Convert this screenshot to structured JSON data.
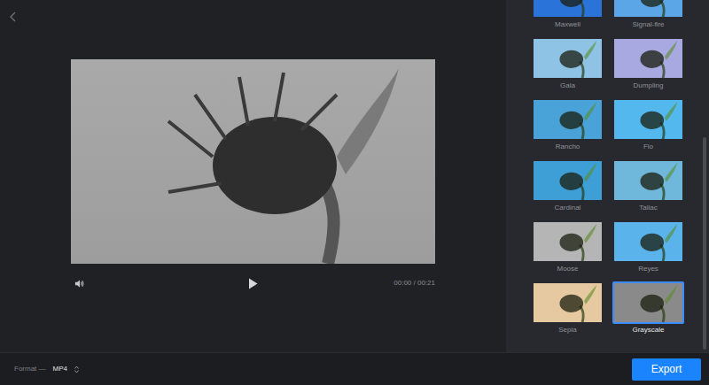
{
  "player": {
    "time": "00:00 / 00:21"
  },
  "filters": [
    {
      "name": "Maxwell",
      "selected": false,
      "color": "#2a73d9"
    },
    {
      "name": "Signal-fire",
      "selected": false,
      "color": "#5aa6e6"
    },
    {
      "name": "Gala",
      "selected": false,
      "color": "#8ec3e6"
    },
    {
      "name": "Dumpling",
      "selected": false,
      "color": "#a8a9e0"
    },
    {
      "name": "Rancho",
      "selected": false,
      "color": "#4aa3d8"
    },
    {
      "name": "Flo",
      "selected": false,
      "color": "#52b8ee"
    },
    {
      "name": "Cardinal",
      "selected": false,
      "color": "#3d9fd6"
    },
    {
      "name": "Tallac",
      "selected": false,
      "color": "#6fb7db"
    },
    {
      "name": "Moose",
      "selected": false,
      "color": "#b5b5b5"
    },
    {
      "name": "Reyes",
      "selected": false,
      "color": "#5ab3ea"
    },
    {
      "name": "Sepia",
      "selected": false,
      "color": "#e6c9a0"
    },
    {
      "name": "Grayscale",
      "selected": true,
      "color": "#8a8a8a"
    }
  ],
  "format": {
    "label": "Format —",
    "value": "MP4"
  },
  "buttons": [
    "Export"
  ]
}
